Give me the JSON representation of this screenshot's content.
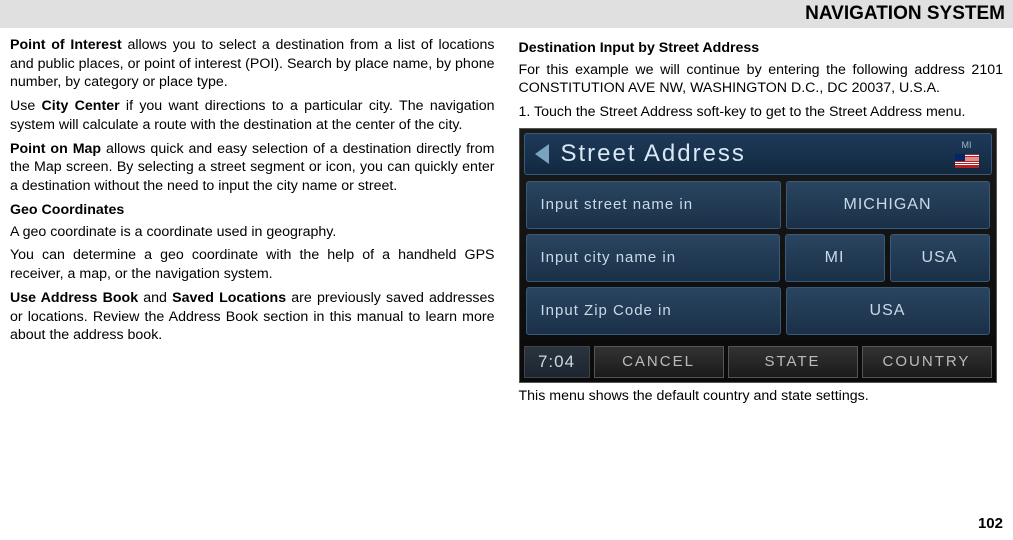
{
  "header": {
    "title": "NAVIGATION SYSTEM"
  },
  "left_column": {
    "p1_bold": "Point of Interest",
    "p1_text": " allows you to select a destination from a list of locations and public places, or point of interest (POI). Search by place name, by phone number, by category or place type.",
    "p2_pre": "Use ",
    "p2_bold": "City Center",
    "p2_text": " if you want directions to a particular city. The navigation system will calculate a route with the destination at the center of the city.",
    "p3_bold": "Point on Map",
    "p3_text": " allows quick and easy selection of a destination directly from the Map screen. By selecting a street segment or icon, you can quickly enter a destination without the need to input the city name or street.",
    "geo_heading": "Geo Coordinates",
    "p4_text": "A geo coordinate is a coordinate used in geography.",
    "p5_text": "You can determine a geo coordinate with the help of a handheld GPS receiver, a map, or the navigation system.",
    "p6_bold1": "Use Address Book",
    "p6_mid": " and ",
    "p6_bold2": "Saved Locations",
    "p6_text": " are previously saved addresses or locations. Review the Address Book section in this manual to learn more about the address book."
  },
  "right_column": {
    "heading": "Destination Input by Street Address",
    "p1": "For this example we will continue by entering the following address 2101 CONSTITUTION AVE NW, WASHINGTON D.C., DC 20037, U.S.A.",
    "p2": "1. Touch the Street Address soft-key to get to the Street Address menu.",
    "caption": "This menu shows the default country and state settings."
  },
  "screen": {
    "title": "Street Address",
    "flag_label": "MI",
    "row1_label": "Input street name in",
    "row1_btn": "MICHIGAN",
    "row2_label": "Input city name in",
    "row2_btn1": "MI",
    "row2_btn2": "USA",
    "row3_label": "Input Zip Code in",
    "row3_btn": "USA",
    "time": "7:04",
    "btn_cancel": "CANCEL",
    "btn_state": "STATE",
    "btn_country": "COUNTRY"
  },
  "page_number": "102"
}
